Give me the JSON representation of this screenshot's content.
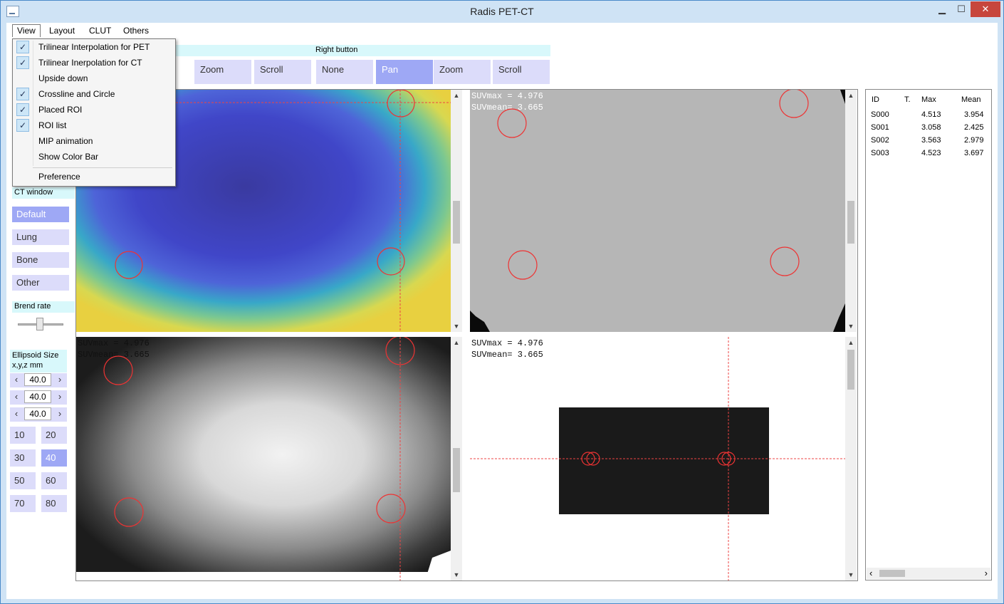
{
  "window": {
    "title": "Radis PET-CT"
  },
  "menu": [
    "View",
    "Layout",
    "CLUT",
    "Others"
  ],
  "view_menu": {
    "items": [
      {
        "label": "Trilinear Interpolation for PET",
        "checked": true
      },
      {
        "label": "Trilinear Inerpolation for CT",
        "checked": true
      },
      {
        "label": "Upside down",
        "checked": false
      },
      {
        "label": "Crossline and Circle",
        "checked": true
      },
      {
        "label": "Placed ROI",
        "checked": true
      },
      {
        "label": "ROI list",
        "checked": true
      },
      {
        "label": "MIP animation",
        "checked": false
      },
      {
        "label": "Show Color Bar",
        "checked": false
      }
    ],
    "preference": "Preference"
  },
  "left_button": {
    "buttons": [
      "Zoom",
      "Scroll"
    ]
  },
  "right_button": {
    "label": "Right button",
    "buttons": [
      "None",
      "Pan",
      "Zoom",
      "Scroll"
    ],
    "selected": "Pan"
  },
  "ct_window": {
    "label": "CT window",
    "options": [
      "Default",
      "Lung",
      "Bone",
      "Other"
    ],
    "selected": "Default"
  },
  "blend_rate": {
    "label": "Brend rate",
    "value": 0.5
  },
  "ellipsoid": {
    "label_line1": "Ellipsoid Size",
    "label_line2": "x,y,z mm",
    "x": "40.0",
    "y": "40.0",
    "z": "40.0",
    "presets": [
      "10",
      "20",
      "30",
      "40",
      "50",
      "60",
      "70",
      "80"
    ],
    "selected": "40"
  },
  "suv": {
    "max": "SUVmax = 4.976",
    "mean": "SUVmean= 3.665"
  },
  "roi_table": {
    "headers": [
      "ID",
      "T.",
      "Max",
      "Mean"
    ],
    "rows": [
      [
        "S000",
        "",
        "4.513",
        "3.954"
      ],
      [
        "S001",
        "",
        "3.058",
        "2.425"
      ],
      [
        "S002",
        "",
        "3.563",
        "2.979"
      ],
      [
        "S003",
        "",
        "4.523",
        "3.697"
      ]
    ]
  },
  "icons": {
    "check": "✓",
    "left": "‹",
    "right": "›",
    "up": "▲",
    "down": "▼"
  }
}
